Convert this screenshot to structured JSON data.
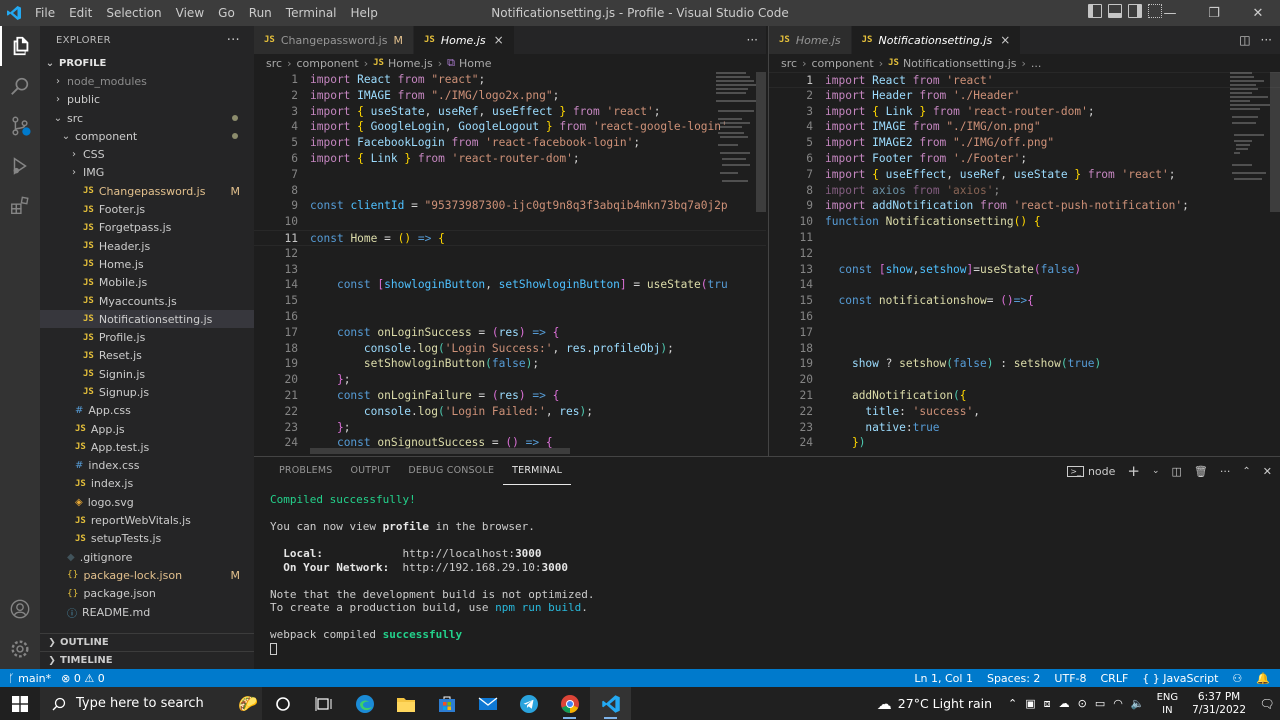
{
  "titlebar": {
    "menus": [
      "File",
      "Edit",
      "Selection",
      "View",
      "Go",
      "Run",
      "Terminal",
      "Help"
    ],
    "title": "Notificationsetting.js - Profile - Visual Studio Code",
    "controls": [
      "—",
      "❐",
      "✕"
    ]
  },
  "sidebar": {
    "header": "EXPLORER",
    "more": "···",
    "root": "PROFILE",
    "items": [
      {
        "label": "node_modules",
        "type": "folder",
        "depth": 1,
        "expanded": false,
        "dim": true
      },
      {
        "label": "public",
        "type": "folder",
        "depth": 1,
        "expanded": false
      },
      {
        "label": "src",
        "type": "folder",
        "depth": 1,
        "expanded": true,
        "dot": true
      },
      {
        "label": "component",
        "type": "folder",
        "depth": 2,
        "expanded": true,
        "dot": true
      },
      {
        "label": "CSS",
        "type": "folder",
        "depth": 3,
        "expanded": false
      },
      {
        "label": "IMG",
        "type": "folder",
        "depth": 3,
        "expanded": false
      },
      {
        "label": "Changepassword.js",
        "type": "js",
        "depth": 3,
        "modified": "M"
      },
      {
        "label": "Footer.js",
        "type": "js",
        "depth": 3
      },
      {
        "label": "Forgetpass.js",
        "type": "js",
        "depth": 3
      },
      {
        "label": "Header.js",
        "type": "js",
        "depth": 3
      },
      {
        "label": "Home.js",
        "type": "js",
        "depth": 3
      },
      {
        "label": "Mobile.js",
        "type": "js",
        "depth": 3
      },
      {
        "label": "Myaccounts.js",
        "type": "js",
        "depth": 3
      },
      {
        "label": "Notificationsetting.js",
        "type": "js",
        "depth": 3,
        "selected": true
      },
      {
        "label": "Profile.js",
        "type": "js",
        "depth": 3
      },
      {
        "label": "Reset.js",
        "type": "js",
        "depth": 3
      },
      {
        "label": "Signin.js",
        "type": "js",
        "depth": 3
      },
      {
        "label": "Signup.js",
        "type": "js",
        "depth": 3
      },
      {
        "label": "App.css",
        "type": "css",
        "depth": 2
      },
      {
        "label": "App.js",
        "type": "js",
        "depth": 2
      },
      {
        "label": "App.test.js",
        "type": "js",
        "depth": 2
      },
      {
        "label": "index.css",
        "type": "css",
        "depth": 2
      },
      {
        "label": "index.js",
        "type": "js",
        "depth": 2
      },
      {
        "label": "logo.svg",
        "type": "svg",
        "depth": 2
      },
      {
        "label": "reportWebVitals.js",
        "type": "js",
        "depth": 2
      },
      {
        "label": "setupTests.js",
        "type": "js",
        "depth": 2
      },
      {
        "label": ".gitignore",
        "type": "git",
        "depth": 1
      },
      {
        "label": "package-lock.json",
        "type": "json",
        "depth": 1,
        "modified": "M"
      },
      {
        "label": "package.json",
        "type": "json",
        "depth": 1
      },
      {
        "label": "README.md",
        "type": "md",
        "depth": 1
      }
    ],
    "outline": "OUTLINE",
    "timeline": "TIMELINE"
  },
  "editor1": {
    "tabs": [
      {
        "label": "Changepassword.js",
        "mod": "M",
        "active": false
      },
      {
        "label": "Home.js",
        "active": true,
        "italic": true,
        "close": "×"
      }
    ],
    "more": "···",
    "breadcrumb": [
      "src",
      "component",
      "Home.js",
      "Home"
    ],
    "lines": [
      {
        "n": "1",
        "html": "<span class='k'>import</span> <span class='v'>React</span> <span class='k'>from</span> <span class='s'>\"react\"</span>;"
      },
      {
        "n": "2",
        "html": "<span class='k'>import</span> <span class='v'>IMAGE</span> <span class='k'>from</span> <span class='s'>\"./IMG/logo2x.png\"</span>;"
      },
      {
        "n": "3",
        "html": "<span class='k'>import</span> <span class='y'>{</span> <span class='v'>useState</span>, <span class='v'>useRef</span>, <span class='v'>useEffect</span> <span class='y'>}</span> <span class='k'>from</span> <span class='s'>'react'</span>;"
      },
      {
        "n": "4",
        "html": "<span class='k'>import</span> <span class='y'>{</span> <span class='v'>GoogleLogin</span>, <span class='v'>GoogleLogout</span> <span class='y'>}</span> <span class='k'>from</span> <span class='s'>'react-google-login'</span>"
      },
      {
        "n": "5",
        "html": "<span class='k'>import</span> <span class='v'>FacebookLogin</span> <span class='k'>from</span> <span class='s'>'react-facebook-login'</span>;"
      },
      {
        "n": "6",
        "html": "<span class='k'>import</span> <span class='y'>{</span> <span class='v'>Link</span> <span class='y'>}</span> <span class='k'>from</span> <span class='s'>'react-router-dom'</span>;"
      },
      {
        "n": "7",
        "html": ""
      },
      {
        "n": "8",
        "html": ""
      },
      {
        "n": "9",
        "html": "<span class='b'>const</span> <span class='c'>clientId</span> = <span class='s'>\"95373987300-ijc0gt9n8q3f3abqib4mkn73bq7a0j2p</span>"
      },
      {
        "n": "10",
        "html": ""
      },
      {
        "n": "11",
        "html": "<span class='b'>const</span> <span class='f'>Home</span> = <span class='y'>()</span> <span class='b'>=&gt;</span> <span class='y'>{</span>",
        "cur": true
      },
      {
        "n": "12",
        "html": ""
      },
      {
        "n": "13",
        "html": ""
      },
      {
        "n": "14",
        "html": "    <span class='b'>const</span> <span class='p'>[</span><span class='c'>showloginButton</span>, <span class='c'>setShowloginButton</span><span class='p'>]</span> = <span class='f'>useState</span><span class='p'>(</span><span class='b'>tru</span>"
      },
      {
        "n": "15",
        "html": ""
      },
      {
        "n": "16",
        "html": ""
      },
      {
        "n": "17",
        "html": "    <span class='b'>const</span> <span class='f'>onLoginSuccess</span> = <span class='p'>(</span><span class='v'>res</span><span class='p'>)</span> <span class='b'>=&gt;</span> <span class='p'>{</span>"
      },
      {
        "n": "18",
        "html": "        <span class='v'>console</span>.<span class='f'>log</span><span class='t'>(</span><span class='s'>'Login Success:'</span>, <span class='v'>res</span>.<span class='v'>profileObj</span><span class='t'>)</span>;"
      },
      {
        "n": "19",
        "html": "        <span class='f'>setShowloginButton</span><span class='t'>(</span><span class='b'>false</span><span class='t'>)</span>;"
      },
      {
        "n": "20",
        "html": "    <span class='p'>}</span>;"
      },
      {
        "n": "21",
        "html": "    <span class='b'>const</span> <span class='f'>onLoginFailure</span> = <span class='p'>(</span><span class='v'>res</span><span class='p'>)</span> <span class='b'>=&gt;</span> <span class='p'>{</span>"
      },
      {
        "n": "22",
        "html": "        <span class='v'>console</span>.<span class='f'>log</span><span class='t'>(</span><span class='s'>'Login Failed:'</span>, <span class='v'>res</span><span class='t'>)</span>;"
      },
      {
        "n": "23",
        "html": "    <span class='p'>}</span>;"
      },
      {
        "n": "24",
        "html": "    <span class='b'>const</span> <span class='f'>onSignoutSuccess</span> = <span class='p'>()</span> <span class='b'>=&gt;</span> <span class='p'>{</span>"
      }
    ]
  },
  "editor2": {
    "tabs": [
      {
        "label": "Home.js",
        "active": false
      },
      {
        "label": "Notificationsetting.js",
        "active": true,
        "italic": true,
        "close": "×"
      }
    ],
    "breadcrumb": [
      "src",
      "component",
      "Notificationsetting.js",
      "..."
    ],
    "lines": [
      {
        "n": "1",
        "html": "<span class='k'>import</span> <span class='v'>React</span> <span class='k'>from</span> <span class='s'>'react'</span>",
        "cur": true
      },
      {
        "n": "2",
        "html": "<span class='k'>import</span> <span class='v'>Header</span> <span class='k'>from</span> <span class='s'>'./Header'</span>"
      },
      {
        "n": "3",
        "html": "<span class='k'>import</span> <span class='y'>{</span> <span class='v'>Link</span> <span class='y'>}</span> <span class='k'>from</span> <span class='s'>'react-router-dom'</span>;"
      },
      {
        "n": "4",
        "html": "<span class='k'>import</span> <span class='v'>IMAGE</span> <span class='k'>from</span> <span class='s'>\"./IMG/on.png\"</span>"
      },
      {
        "n": "5",
        "html": "<span class='k'>import</span> <span class='v'>IMAGE2</span> <span class='k'>from</span> <span class='s'>\"./IMG/off.png\"</span>"
      },
      {
        "n": "6",
        "html": "<span class='k'>import</span> <span class='v'>Footer</span> <span class='k'>from</span> <span class='s'>'./Footer'</span>;"
      },
      {
        "n": "7",
        "html": "<span class='k'>import</span> <span class='y'>{</span> <span class='v'>useEffect</span>, <span class='v'>useRef</span>, <span class='v'>useState</span> <span class='y'>}</span> <span class='k'>from</span> <span class='s'>'react'</span>;"
      },
      {
        "n": "8",
        "html": "<span class='dim'><span class='k'>import</span> <span class='v'>axios</span> <span class='k'>from</span> <span class='s'>'axios'</span>;</span>"
      },
      {
        "n": "9",
        "html": "<span class='k'>import</span> <span class='v'>addNotification</span> <span class='k'>from</span> <span class='s'>'react-push-notification'</span>;"
      },
      {
        "n": "10",
        "html": "<span class='b'>function</span> <span class='f'>Notificationsetting</span><span class='y'>()</span> <span class='y'>{</span>"
      },
      {
        "n": "11",
        "html": ""
      },
      {
        "n": "12",
        "html": ""
      },
      {
        "n": "13",
        "html": "  <span class='b'>const</span> <span class='p'>[</span><span class='c'>show</span>,<span class='c'>setshow</span><span class='p'>]</span>=<span class='f'>useState</span><span class='p'>(</span><span class='b'>false</span><span class='p'>)</span>"
      },
      {
        "n": "14",
        "html": ""
      },
      {
        "n": "15",
        "html": "  <span class='b'>const</span> <span class='f'>notificationshow</span>= <span class='p'>()</span><span class='b'>=&gt;</span><span class='p'>{</span>"
      },
      {
        "n": "16",
        "html": ""
      },
      {
        "n": "17",
        "html": ""
      },
      {
        "n": "18",
        "html": ""
      },
      {
        "n": "19",
        "html": "    <span class='v'>show</span> ? <span class='f'>setshow</span><span class='t'>(</span><span class='b'>false</span><span class='t'>)</span> : <span class='f'>setshow</span><span class='t'>(</span><span class='b'>true</span><span class='t'>)</span>"
      },
      {
        "n": "20",
        "html": ""
      },
      {
        "n": "21",
        "html": "    <span class='f'>addNotification</span><span class='t'>(</span><span class='y'>{</span>"
      },
      {
        "n": "22",
        "html": "      <span class='v'>title</span>: <span class='s'>'success'</span>,"
      },
      {
        "n": "23",
        "html": "      <span class='v'>native</span>:<span class='b'>true</span>"
      },
      {
        "n": "24",
        "html": "    <span class='y'>}</span><span class='t'>)</span>"
      }
    ]
  },
  "panel": {
    "tabs": [
      "PROBLEMS",
      "OUTPUT",
      "DEBUG CONSOLE",
      "TERMINAL"
    ],
    "active_tab": "TERMINAL",
    "shell": "node",
    "terminal_lines": [
      {
        "html": "<span class='green'>Compiled successfully!</span>"
      },
      {
        "html": ""
      },
      {
        "html": "You can now view <span class='bold'>profile</span> in the browser."
      },
      {
        "html": ""
      },
      {
        "html": "  <span class='bold'>Local:</span>            http://localhost:<span class='bold'>3000</span>"
      },
      {
        "html": "  <span class='bold'>On Your Network:</span>  http://192.168.29.10:<span class='bold'>3000</span>"
      },
      {
        "html": ""
      },
      {
        "html": "Note that the development build is not optimized."
      },
      {
        "html": "To create a production build, use <span class='cyan'>npm run build</span>."
      },
      {
        "html": ""
      },
      {
        "html": "webpack compiled <span class='green' style='font-weight:bold'>successfully</span>"
      },
      {
        "html": "<span class='cursor-box'></span>"
      }
    ]
  },
  "statusbar": {
    "branch": "main*",
    "errors": "0",
    "warnings": "0",
    "position": "Ln 1, Col 1",
    "spaces": "Spaces: 2",
    "encoding": "UTF-8",
    "eol": "CRLF",
    "language": "JavaScript"
  },
  "taskbar": {
    "search_placeholder": "Type here to search",
    "weather": "27°C  Light rain",
    "lang_top": "ENG",
    "lang_bottom": "IN",
    "time": "6:37 PM",
    "date": "7/31/2022"
  },
  "colors": {
    "accent": "#007acc",
    "editor_bg": "#1e1e1e",
    "sidebar_bg": "#252526",
    "activity_bg": "#333333"
  }
}
